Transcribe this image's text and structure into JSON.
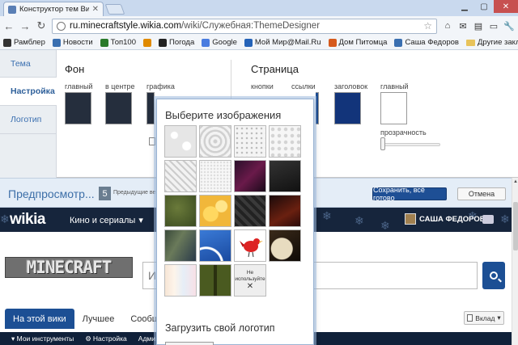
{
  "browser": {
    "tab_title": "Конструктор тем Викия",
    "url_host": "ru.minecraftstyle.wikia.com",
    "url_path": "/wiki/Служебная:ThemeDesigner",
    "bookmarks": [
      {
        "label": "Рамблер",
        "color": "#333333"
      },
      {
        "label": "Новости",
        "color": "#3a6fb0"
      },
      {
        "label": "Топ100",
        "color": "#2a7a2a"
      },
      {
        "label": "",
        "color": "#e08a00"
      },
      {
        "label": "Погода",
        "color": "#222222"
      },
      {
        "label": "Google",
        "color": "#4a7de0"
      },
      {
        "label": "Мой Мир@Mail.Ru",
        "color": "#2563b8"
      },
      {
        "label": "Дом Питомца",
        "color": "#d65a1c"
      },
      {
        "label": "Саша Федоров",
        "color": "#3a6fb0"
      }
    ],
    "other_bookmarks": "Другие закладки"
  },
  "designer": {
    "tabs": [
      "Тема",
      "Настройка",
      "Логотип"
    ],
    "background_title": "Фон",
    "background_labels": [
      "главный",
      "в центре",
      "графика"
    ],
    "page_title": "Страница",
    "page_labels": [
      "кнопки",
      "ссылки",
      "заголовок",
      "главный"
    ],
    "transparency_label": "прозрачность",
    "colors": {
      "bg_main": "#252e3d",
      "bg_center": "#252e3d",
      "buttons": "#1d4d92",
      "links": "#1d4d92",
      "header": "#12347a",
      "page_main": "#ffffff"
    }
  },
  "picker": {
    "title": "Выберите изображения",
    "no_image_label_1": "Не",
    "no_image_label_2": "используйте",
    "upload_title": "Загрузить свой логотип"
  },
  "preview": {
    "title": "Предпросмотр...",
    "count": "5",
    "previous": "Предыдущие ве",
    "save": "Сохранить, всё готово",
    "cancel": "Отмена"
  },
  "wikia": {
    "logo": "wikia",
    "nav": "Кино и сериалы",
    "nav_arrow": "▾",
    "user": "САША ФЕДОРОВ",
    "user_arrow": "▾",
    "site_logo": "MINECRAFT",
    "search_placeholder": "И",
    "tabs": [
      "На этой вики",
      "Лучшее",
      "Сообщест"
    ],
    "vklad": "Вклад",
    "bottom": [
      "Мои инструменты",
      "Настройка",
      "Адми"
    ]
  }
}
